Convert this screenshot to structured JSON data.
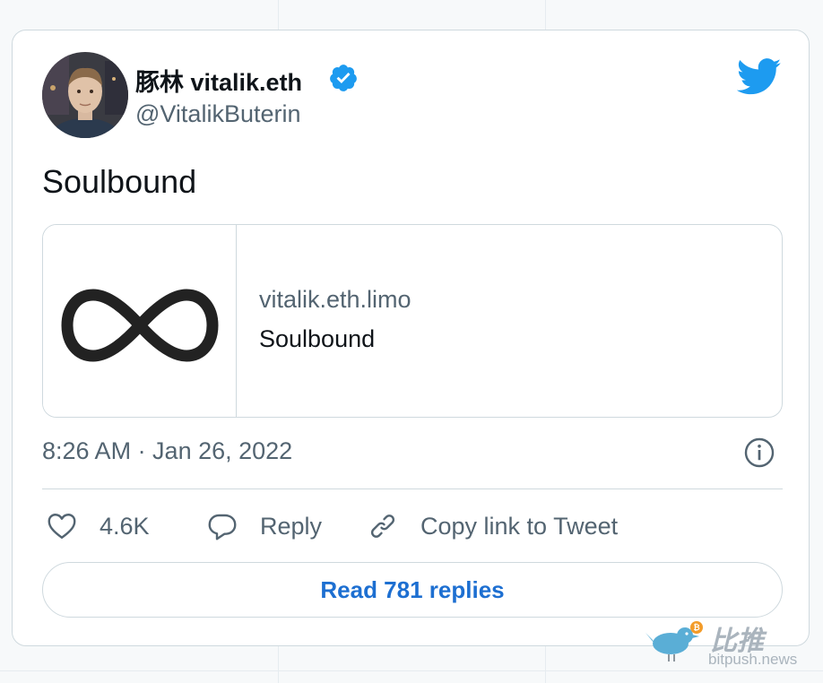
{
  "tweet": {
    "display_name": "豚林 vitalik.eth",
    "handle": "@VitalikButerin",
    "text": "Soulbound",
    "timestamp": "8:26 AM · Jan 26, 2022"
  },
  "link_card": {
    "domain": "vitalik.eth.limo",
    "title": "Soulbound",
    "thumbnail_icon": "infinity-icon"
  },
  "actions": {
    "like_count": "4.6K",
    "reply_label": "Reply",
    "copy_link_label": "Copy link to Tweet"
  },
  "read_replies_label": "Read 781 replies",
  "watermark": {
    "cn_text": "比推",
    "site": "bitpush.news"
  },
  "colors": {
    "twitter_blue": "#1d9bf0",
    "link_blue": "#1d6fd1",
    "secondary_text": "#536471",
    "border": "#cfd9de"
  }
}
